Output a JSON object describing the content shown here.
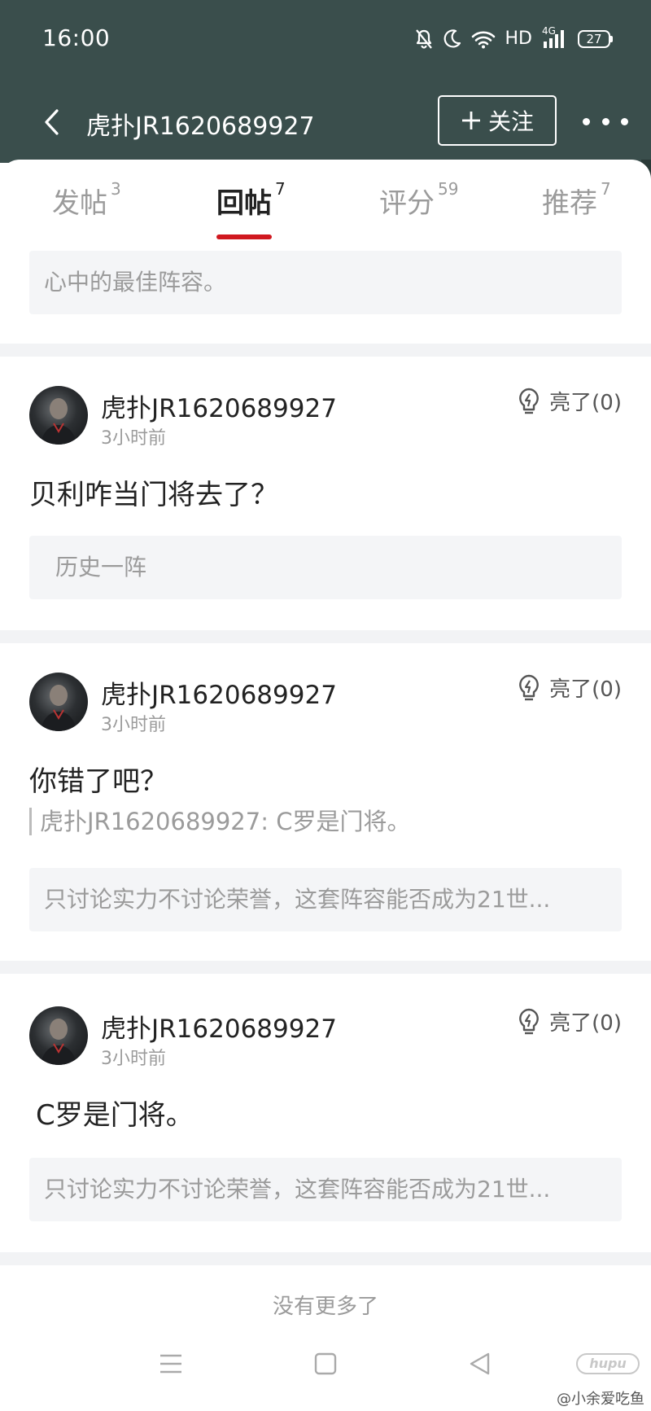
{
  "status": {
    "time": "16:00",
    "network": "HD",
    "signal_label": "4G",
    "battery": "27"
  },
  "nav": {
    "title": "虎扑JR1620689927",
    "follow_label": "关注"
  },
  "tabs": [
    {
      "label": "发帖",
      "count": "3",
      "active": false
    },
    {
      "label": "回帖",
      "count": "7",
      "active": true
    },
    {
      "label": "评分",
      "count": "59",
      "active": false
    },
    {
      "label": "推荐",
      "count": "7",
      "active": false
    }
  ],
  "top_quote": "心中的最佳阵容。",
  "posts": [
    {
      "username": "虎扑JR1620689927",
      "time": "3小时前",
      "light": "亮了(0)",
      "content": "贝利咋当门将去了？",
      "reply_ref": "",
      "quote": "历史一阵"
    },
    {
      "username": "虎扑JR1620689927",
      "time": "3小时前",
      "light": "亮了(0)",
      "content": "你错了吧？",
      "reply_ref": "虎扑JR1620689927: C罗是门将。",
      "quote": "只讨论实力不讨论荣誉，这套阵容能否成为21世..."
    },
    {
      "username": "虎扑JR1620689927",
      "time": "3小时前",
      "light": "亮了(0)",
      "content": "C罗是门将。",
      "reply_ref": "",
      "quote": "只讨论实力不讨论荣誉，这套阵容能否成为21世..."
    }
  ],
  "footer": {
    "no_more": "没有更多了",
    "watermark": "@小余爱吃鱼",
    "logo_text": "hupu"
  },
  "icons": {
    "back": "chevron-left-icon",
    "more": "more-dots-icon",
    "light": "lightbulb-icon",
    "mute": "bell-off-icon",
    "dnd": "moon-icon",
    "wifi": "wifi-icon",
    "signal": "signal-icon"
  },
  "colors": {
    "header_bg": "#3a4e4c",
    "accent": "#d0181f",
    "muted_text": "#9b9b9b",
    "quote_bg": "#f4f5f7"
  }
}
